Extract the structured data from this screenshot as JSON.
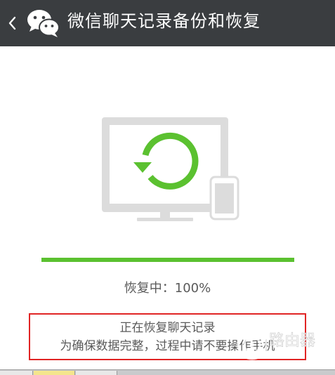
{
  "header": {
    "back_icon": "chevron-left-icon",
    "logo_icon": "wechat-logo-icon",
    "title": "微信聊天记录备份和恢复"
  },
  "illustration": {
    "monitor_icon": "monitor-icon",
    "restore_icon": "restore-refresh-icon",
    "phone_icon": "phone-icon",
    "accent_color": "#5bc130"
  },
  "progress": {
    "value": 1.0,
    "fill_color": "#5bc130",
    "label": "恢复中：100%"
  },
  "notice": {
    "line1": "正在恢复聊天记录",
    "line2": "为确保数据完整，过程中请不要操作手机",
    "border_color": "#e02424"
  },
  "watermark": {
    "text": "路由器"
  }
}
